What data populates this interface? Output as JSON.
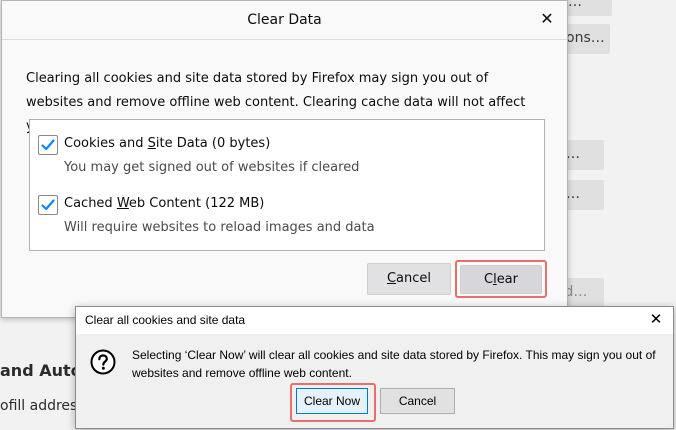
{
  "background": {
    "button_top": "…",
    "button_exceptions": "ons…",
    "button_mid1": "…",
    "button_mid2": "…",
    "button_passwords": "rd…",
    "heading_autofill": "and Autof",
    "text_autofill": "ofill addres"
  },
  "clear_dialog": {
    "title": "Clear Data",
    "close_glyph": "✕",
    "description": "Clearing all cookies and site data stored by Firefox may sign you out of websites and remove offline web content. Clearing cache data will not affect your logins.",
    "options": [
      {
        "label_before": "Cookies and ",
        "label_accesskey": "S",
        "label_after": "ite Data (0 bytes)",
        "subtext": "You may get signed out of websites if cleared",
        "checked": true
      },
      {
        "label_before": "Cached ",
        "label_accesskey": "W",
        "label_after": "eb Content (122 MB)",
        "subtext": "Will require websites to reload images and data",
        "checked": true
      }
    ],
    "cancel_label_accesskey": "C",
    "cancel_label_rest": "ancel",
    "clear_label_before": "C",
    "clear_label_accesskey": "l",
    "clear_label_after": "ear"
  },
  "confirm_dialog": {
    "title": "Clear all cookies and site data",
    "close_glyph": "✕",
    "message": "Selecting ‘Clear Now’ will clear all cookies and site data stored by Firefox. This may sign you out of websites and remove offline web content.",
    "clear_now_label": "Clear Now",
    "cancel_label": "Cancel"
  },
  "colors": {
    "checkbox_accent": "#0a84ff",
    "highlight": "#e56f6a",
    "primary_button_border": "#0078d7"
  }
}
